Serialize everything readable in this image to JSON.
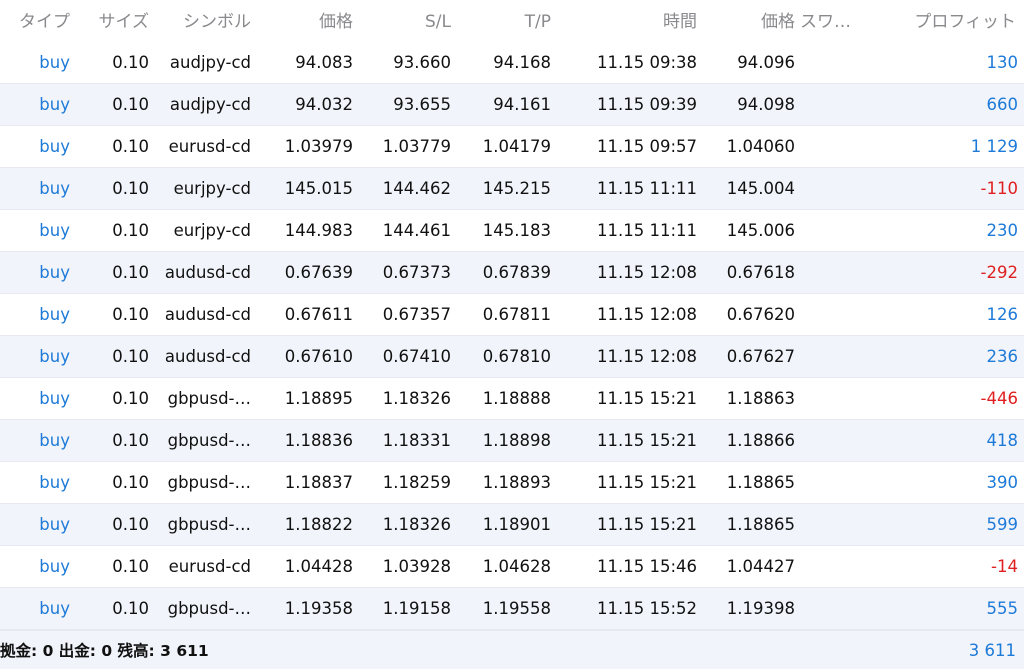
{
  "columns": [
    "タイプ",
    "サイズ",
    "シンボル",
    "価格",
    "S/L",
    "T/P",
    "時間",
    "価格",
    "スワ…",
    "プロフィット"
  ],
  "trades": [
    {
      "type": "buy",
      "size": "0.10",
      "symbol": "audjpy-cd",
      "open_price": "94.083",
      "sl": "93.660",
      "tp": "94.168",
      "time": "11.15 09:38",
      "current_price": "94.096",
      "swap": "",
      "profit": "130",
      "profit_sign": "pos"
    },
    {
      "type": "buy",
      "size": "0.10",
      "symbol": "audjpy-cd",
      "open_price": "94.032",
      "sl": "93.655",
      "tp": "94.161",
      "time": "11.15 09:39",
      "current_price": "94.098",
      "swap": "",
      "profit": "660",
      "profit_sign": "pos"
    },
    {
      "type": "buy",
      "size": "0.10",
      "symbol": "eurusd-cd",
      "open_price": "1.03979",
      "sl": "1.03779",
      "tp": "1.04179",
      "time": "11.15 09:57",
      "current_price": "1.04060",
      "swap": "",
      "profit": "1 129",
      "profit_sign": "pos"
    },
    {
      "type": "buy",
      "size": "0.10",
      "symbol": "eurjpy-cd",
      "open_price": "145.015",
      "sl": "144.462",
      "tp": "145.215",
      "time": "11.15 11:11",
      "current_price": "145.004",
      "swap": "",
      "profit": "-110",
      "profit_sign": "neg"
    },
    {
      "type": "buy",
      "size": "0.10",
      "symbol": "eurjpy-cd",
      "open_price": "144.983",
      "sl": "144.461",
      "tp": "145.183",
      "time": "11.15 11:11",
      "current_price": "145.006",
      "swap": "",
      "profit": "230",
      "profit_sign": "pos"
    },
    {
      "type": "buy",
      "size": "0.10",
      "symbol": "audusd-cd",
      "open_price": "0.67639",
      "sl": "0.67373",
      "tp": "0.67839",
      "time": "11.15 12:08",
      "current_price": "0.67618",
      "swap": "",
      "profit": "-292",
      "profit_sign": "neg"
    },
    {
      "type": "buy",
      "size": "0.10",
      "symbol": "audusd-cd",
      "open_price": "0.67611",
      "sl": "0.67357",
      "tp": "0.67811",
      "time": "11.15 12:08",
      "current_price": "0.67620",
      "swap": "",
      "profit": "126",
      "profit_sign": "pos"
    },
    {
      "type": "buy",
      "size": "0.10",
      "symbol": "audusd-cd",
      "open_price": "0.67610",
      "sl": "0.67410",
      "tp": "0.67810",
      "time": "11.15 12:08",
      "current_price": "0.67627",
      "swap": "",
      "profit": "236",
      "profit_sign": "pos"
    },
    {
      "type": "buy",
      "size": "0.10",
      "symbol": "gbpusd-…",
      "open_price": "1.18895",
      "sl": "1.18326",
      "tp": "1.18888",
      "time": "11.15 15:21",
      "current_price": "1.18863",
      "swap": "",
      "profit": "-446",
      "profit_sign": "neg"
    },
    {
      "type": "buy",
      "size": "0.10",
      "symbol": "gbpusd-…",
      "open_price": "1.18836",
      "sl": "1.18331",
      "tp": "1.18898",
      "time": "11.15 15:21",
      "current_price": "1.18866",
      "swap": "",
      "profit": "418",
      "profit_sign": "pos"
    },
    {
      "type": "buy",
      "size": "0.10",
      "symbol": "gbpusd-…",
      "open_price": "1.18837",
      "sl": "1.18259",
      "tp": "1.18893",
      "time": "11.15 15:21",
      "current_price": "1.18865",
      "swap": "",
      "profit": "390",
      "profit_sign": "pos"
    },
    {
      "type": "buy",
      "size": "0.10",
      "symbol": "gbpusd-…",
      "open_price": "1.18822",
      "sl": "1.18326",
      "tp": "1.18901",
      "time": "11.15 15:21",
      "current_price": "1.18865",
      "swap": "",
      "profit": "599",
      "profit_sign": "pos"
    },
    {
      "type": "buy",
      "size": "0.10",
      "symbol": "eurusd-cd",
      "open_price": "1.04428",
      "sl": "1.03928",
      "tp": "1.04628",
      "time": "11.15 15:46",
      "current_price": "1.04427",
      "swap": "",
      "profit": "-14",
      "profit_sign": "neg"
    },
    {
      "type": "buy",
      "size": "0.10",
      "symbol": "gbpusd-…",
      "open_price": "1.19358",
      "sl": "1.19158",
      "tp": "1.19558",
      "time": "11.15 15:52",
      "current_price": "1.19398",
      "swap": "",
      "profit": "555",
      "profit_sign": "pos"
    }
  ],
  "footer": {
    "summary": "拠金: 0 出金: 0 残高: 3 611",
    "total_profit": "3 611"
  },
  "colors": {
    "accent_blue": "#1d7ad8",
    "loss_red": "#e02020",
    "row_alt": "#f1f4fa",
    "header_text": "#8a8a8e"
  }
}
